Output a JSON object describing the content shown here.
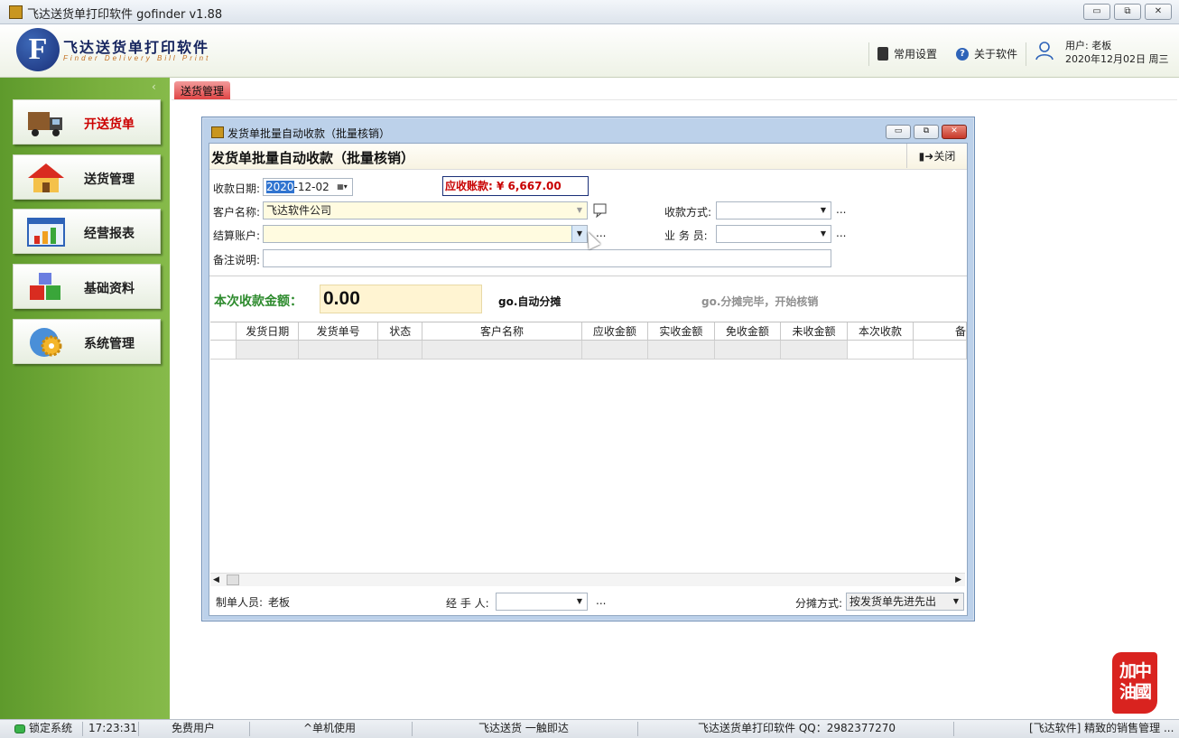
{
  "window": {
    "title": "飞达送货单打印软件   gofinder v1.88",
    "controls": {
      "minimize": "▭",
      "maximize": "⧉",
      "close": "✕"
    }
  },
  "header": {
    "logo_letter": "F",
    "app_name": "飞达送货单打印软件",
    "app_subtitle": "Finder Delivery Bill Print",
    "settings_label": "常用设置",
    "about_label": "关于软件",
    "user_label": "用户: 老板",
    "date_label": "2020年12月02日 周三"
  },
  "sidebar": {
    "collapse_glyph": "‹",
    "items": [
      {
        "label": "开送货单",
        "active": true,
        "icon": "truck-icon"
      },
      {
        "label": "送货管理",
        "active": false,
        "icon": "house-icon"
      },
      {
        "label": "经营报表",
        "active": false,
        "icon": "chart-icon"
      },
      {
        "label": "基础资料",
        "active": false,
        "icon": "cubes-icon"
      },
      {
        "label": "系统管理",
        "active": false,
        "icon": "gear-icon"
      }
    ]
  },
  "main": {
    "tab_label": "送货管理"
  },
  "dialog": {
    "window_title": "发货单批量自动收款（批量核销）",
    "heading": "发货单批量自动收款（批量核销）",
    "close_label": "关闭",
    "fields": {
      "date_label": "收款日期:",
      "date_year": "2020",
      "date_rest": "-12-02",
      "receivable": "应收账款: ¥ 6,667.00",
      "customer_label": "客户名称:",
      "customer_value": "飞达软件公司",
      "payment_method_label": "收款方式:",
      "account_label": "结算账户:",
      "salesman_label": "业  务  员:",
      "remark_label": "备注说明:",
      "dots": "..."
    },
    "collect": {
      "label": "本次收款金额：",
      "value": "0.00",
      "auto_allocate": "go.自动分摊",
      "allocate_done": "go.分摊完毕，开始核销"
    },
    "table": {
      "columns": [
        "",
        "发货日期",
        "发货单号",
        "状态",
        "客户名称",
        "应收金额",
        "实收金额",
        "免收金额",
        "未收金额",
        "本次收款",
        "备"
      ]
    },
    "footer": {
      "creator_label": "制单人员:",
      "creator_value": "老板",
      "handler_label": "经  手  人:",
      "alloc_label": "分摊方式:",
      "alloc_value": "按发货单先进先出"
    }
  },
  "statusbar": {
    "lock": "锁定系统",
    "time": "17:23:31",
    "license": "免费用户",
    "mode": "^单机使用",
    "slogan": "飞达送货 一触即达",
    "qq": "飞达送货单打印软件 QQ：2982377270",
    "ad": "[飞达软件] 精致的销售管理 ..."
  },
  "stamp": {
    "text": "加中油國"
  }
}
